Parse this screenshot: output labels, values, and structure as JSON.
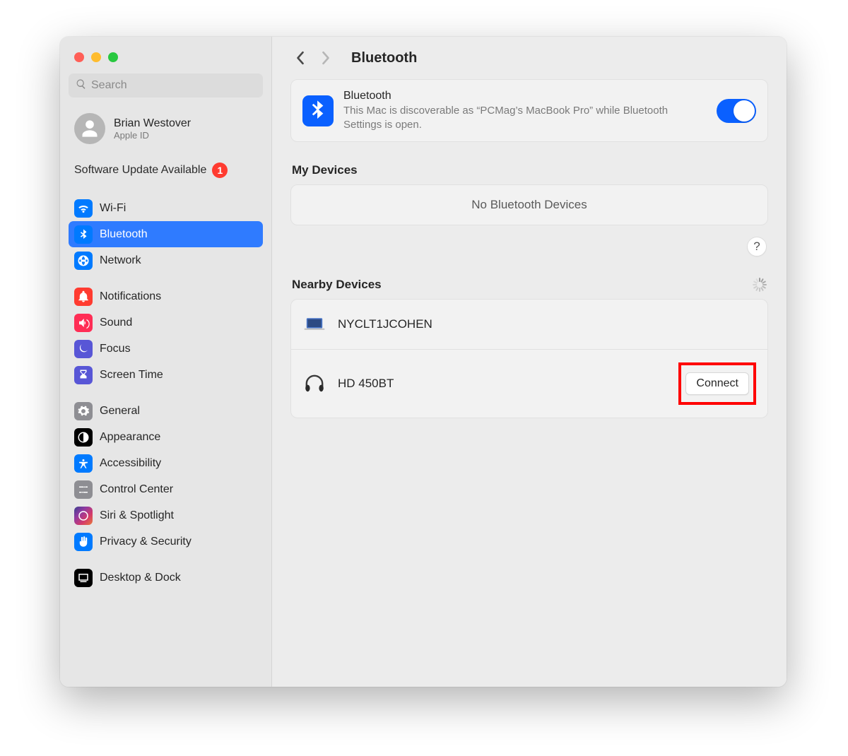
{
  "window": {
    "search_placeholder": "Search",
    "account": {
      "name": "Brian Westover",
      "subtitle": "Apple ID"
    },
    "update": {
      "label": "Software Update Available",
      "count": "1"
    }
  },
  "sidebar": {
    "group1": [
      {
        "label": "Wi-Fi"
      },
      {
        "label": "Bluetooth"
      },
      {
        "label": "Network"
      }
    ],
    "group2": [
      {
        "label": "Notifications"
      },
      {
        "label": "Sound"
      },
      {
        "label": "Focus"
      },
      {
        "label": "Screen Time"
      }
    ],
    "group3": [
      {
        "label": "General"
      },
      {
        "label": "Appearance"
      },
      {
        "label": "Accessibility"
      },
      {
        "label": "Control Center"
      },
      {
        "label": "Siri & Spotlight"
      },
      {
        "label": "Privacy & Security"
      }
    ],
    "group4": [
      {
        "label": "Desktop & Dock"
      }
    ]
  },
  "header": {
    "title": "Bluetooth"
  },
  "bluetooth": {
    "title": "Bluetooth",
    "subtitle": "This Mac is discoverable as “PCMag’s MacBook Pro” while Bluetooth Settings is open.",
    "on": true
  },
  "sections": {
    "my_devices": {
      "title": "My Devices",
      "empty": "No Bluetooth Devices"
    },
    "nearby": {
      "title": "Nearby Devices",
      "items": [
        {
          "name": "NYCLT1JCOHEN"
        },
        {
          "name": "HD 450BT",
          "action": "Connect"
        }
      ]
    }
  },
  "help": "?"
}
